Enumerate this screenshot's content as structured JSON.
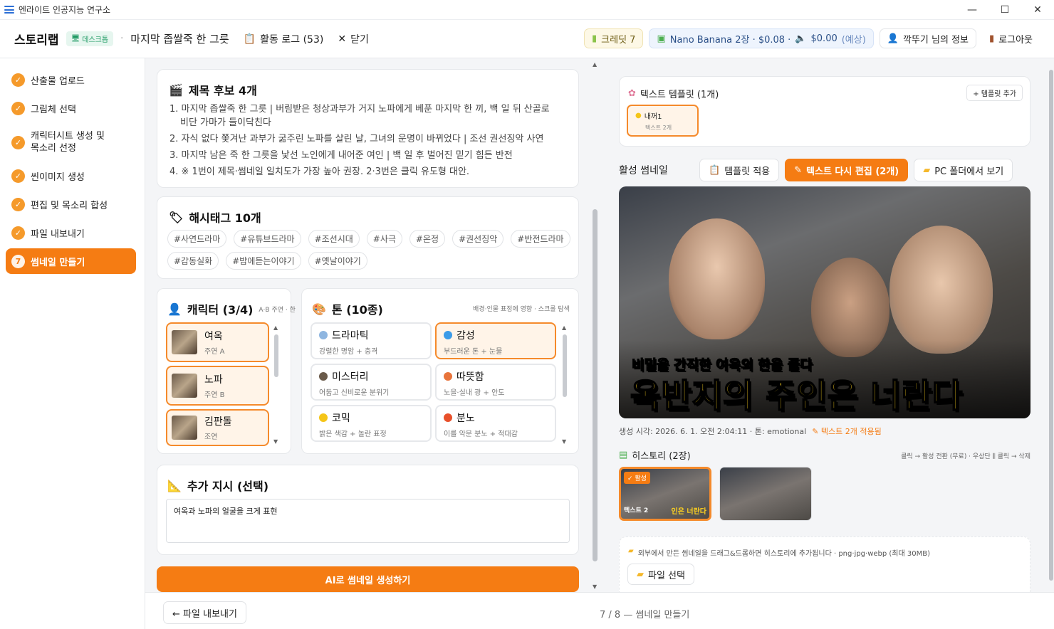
{
  "window": {
    "title": "엔라이트 인공지능 연구소",
    "minimize": "—",
    "maximize": "☐",
    "close": "✕"
  },
  "header": {
    "brand": "스토리랩",
    "badge": "데스크톱",
    "sep": "·",
    "project": "마지막 좁쌀죽 한 그릇",
    "activity_log": "활동 로그 (53)",
    "close_label": "닫기",
    "credit": "크레딧 7",
    "cost_model": "Nano Banana 2장 · $0.08 ·",
    "cost_audio": "$0.00",
    "cost_est": "(예상)",
    "user": "깍뚜기 님의 정보",
    "logout": "로그아웃"
  },
  "sidebar": {
    "items": [
      {
        "label": "산출물 업로드",
        "mark": "✓"
      },
      {
        "label": "그림체 선택",
        "mark": "✓"
      },
      {
        "label": "캐릭터시트 생성 및",
        "label2": "목소리 선정",
        "mark": "✓"
      },
      {
        "label": "씬이미지 생성",
        "mark": "✓"
      },
      {
        "label": "편집 및 목소리 합성",
        "mark": "✓"
      },
      {
        "label": "파일 내보내기",
        "mark": "✓"
      },
      {
        "label": "썸네일 만들기",
        "mark": "7"
      }
    ]
  },
  "titles": {
    "heading": "제목 후보 4개",
    "items": [
      "1. 마지막 좁쌀죽 한 그릇 | 버림받은 청상과부가 거지 노파에게 베푼 마지막 한 끼, 백 일 뒤 산골로",
      "비단 가마가 들이닥친다",
      "2. 자식 없다 쫓겨난 과부가 굶주린 노파를 살린 날, 그녀의 운명이 바뀌었다 | 조선 권선징악 사연",
      "3. 마지막 남은 죽 한 그릇을 낯선 노인에게 내어준 여인 | 백 일 후 벌어진 믿기 힘든 반전",
      "4. ※ 1번이 제목·썸네일 일치도가 가장 높아 권장. 2·3번은 클릭 유도형 대안."
    ]
  },
  "hashtags": {
    "heading": "해시태그 10개",
    "row1": [
      "#사연드라마",
      "#유튜브드라마",
      "#조선시대",
      "#사극",
      "#온정",
      "#권선징악",
      "#반전드라마"
    ],
    "row2": [
      "#감동실화",
      "#밤에듣는이야기",
      "#옛날이야기"
    ]
  },
  "characters": {
    "heading": "캐릭터 (3/4)",
    "sub": "A·B 주연 · 한",
    "items": [
      {
        "name": "여옥",
        "role": "주연 A"
      },
      {
        "name": "노파",
        "role": "주연 B"
      },
      {
        "name": "김판돌",
        "role": "조연"
      }
    ]
  },
  "tones": {
    "heading": "톤 (10종)",
    "sub": "배경·인물 표정에 영향 · 스크롤 탐색",
    "items": [
      {
        "name": "드라마틱",
        "desc": "강렬한 명암 + 충격"
      },
      {
        "name": "감성",
        "desc": "부드러운 톤 + 눈물"
      },
      {
        "name": "미스터리",
        "desc": "어둡고 신비로운 분위기"
      },
      {
        "name": "따뜻함",
        "desc": "노을·실내 광 + 안도"
      },
      {
        "name": "코믹",
        "desc": "밝은 색감 + 놀란 표정"
      },
      {
        "name": "분노",
        "desc": "이를 악문 분노 + 적대감"
      }
    ]
  },
  "extra": {
    "heading": "추가 지시 (선택)",
    "value": "여옥과 노파의 얼굴을 크게 표현"
  },
  "generate_button": "AI로 썸네일 생성하기",
  "bottom": {
    "export": "← 파일 내보내기",
    "progress": "7 / 8 — 썸네일 만들기"
  },
  "templates": {
    "heading": "텍스트 템플릿 (1개)",
    "add": "+ 템플릿 추가",
    "item_name": "내꺼1",
    "item_sub": "텍스트 2개"
  },
  "active_thumb": {
    "heading": "활성 썸네일",
    "apply": "템플릿 적용",
    "reedit": "텍스트 다시 편집 (2개)",
    "folder": "PC 폴더에서 보기",
    "line1": "비밀을 간직한 여옥의 한을 풀다",
    "line2": "옥반지의 주인은 너란다",
    "meta": "생성 시각: 2026. 6. 1. 오전 2:04:11 · 톤: emotional",
    "meta_tag": "텍스트 2개 적용됨"
  },
  "history": {
    "heading": "히스토리 (2장)",
    "hint": "클릭 → 활성 전환 (무료) · 우상단 ⫼ 클릭 → 삭제",
    "active_badge": "✓ 활성",
    "overlay": "텍스트 2",
    "overlay2": "인은 너란다"
  },
  "upload": {
    "hint": "외부에서 만든 썸네일을 드래그&드롭하면 히스토리에 추가됩니다 · png·jpg·webp (최대 30MB)",
    "button": "파일 선택"
  },
  "colors": {
    "accent": "#f57c13",
    "accent_light": "#fff4e8"
  }
}
